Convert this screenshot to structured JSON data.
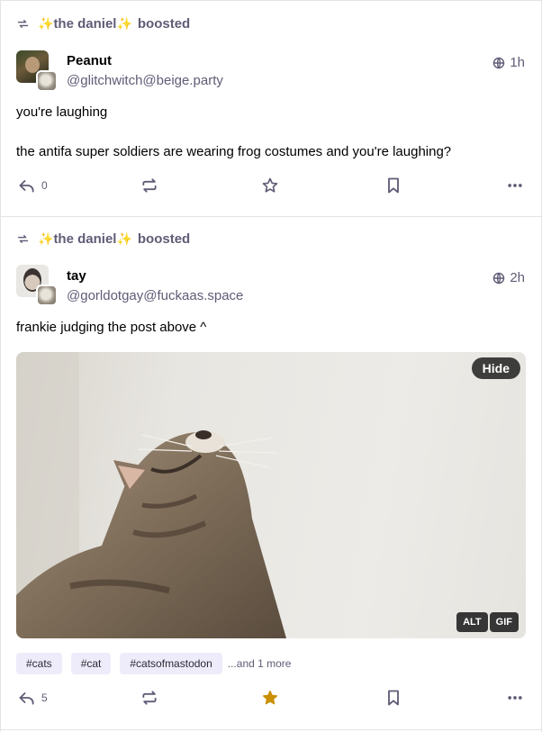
{
  "posts": [
    {
      "boosted_by": "the daniel",
      "boost_verb": "boosted",
      "display_name": "Peanut",
      "acct": "@glitchwitch@beige.party",
      "time": "1h",
      "paragraphs": [
        "you're laughing",
        "the antifa super soldiers are wearing frog costumes and you're laughing?"
      ],
      "reply_count": "0",
      "favourited": false
    },
    {
      "boosted_by": "the daniel",
      "boost_verb": "boosted",
      "display_name": "tay",
      "acct": "@gorldotgay@fuckaas.space",
      "time": "2h",
      "paragraphs": [
        "frankie judging the post above ^"
      ],
      "media": {
        "hide_label": "Hide",
        "alt_badge": "ALT",
        "gif_badge": "GIF"
      },
      "hashtags": [
        "#cats",
        "#cat",
        "#catsofmastodon"
      ],
      "more_tags": "...and 1 more",
      "reply_count": "5",
      "favourited": true
    }
  ],
  "colors": {
    "accent": "#5f5c76",
    "favourite": "#ca8f04",
    "tag_bg": "#eeebfa",
    "sparkle": "#f0b43c"
  },
  "icons": {
    "boost": "retweet-icon",
    "reply": "reply-icon",
    "fav": "star-icon",
    "bookmark": "bookmark-icon",
    "more": "ellipsis-icon",
    "globe": "globe-icon",
    "sparkle": "sparkles-emoji"
  }
}
